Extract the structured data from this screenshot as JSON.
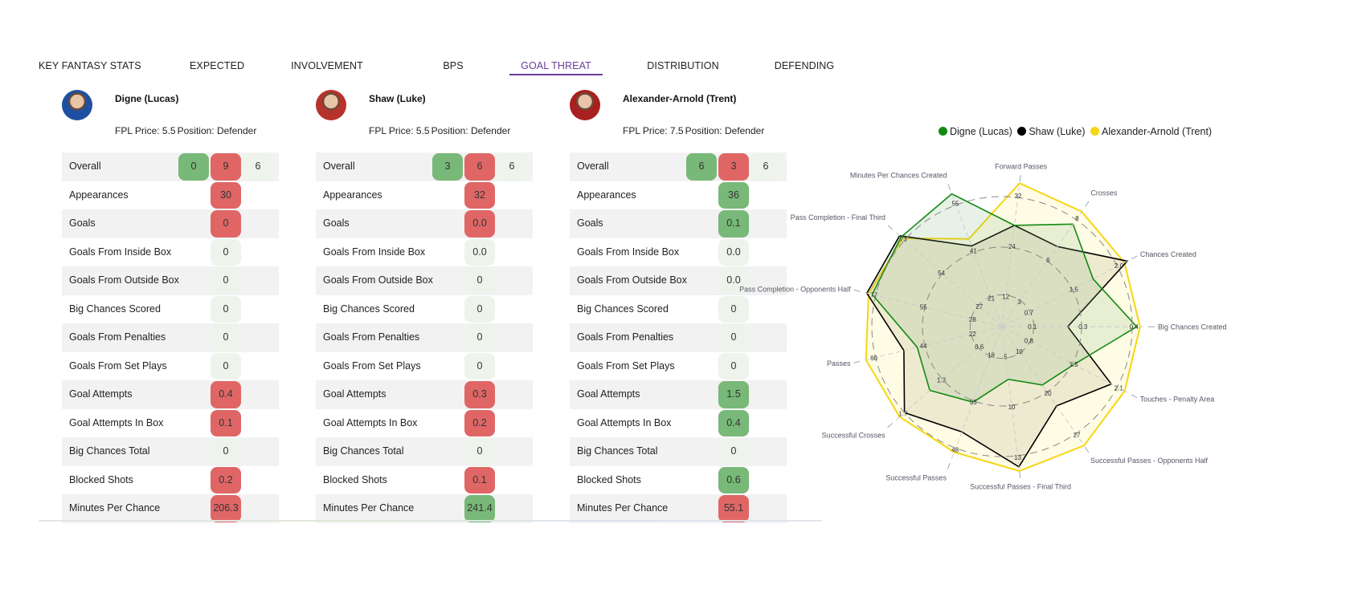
{
  "tabs": [
    {
      "label": "KEY FANTASY STATS",
      "active": false
    },
    {
      "label": "EXPECTED",
      "active": false
    },
    {
      "label": "INVOLVEMENT",
      "active": false
    },
    {
      "label": "BPS",
      "active": false
    },
    {
      "label": "GOAL THREAT",
      "active": true
    },
    {
      "label": "DISTRIBUTION",
      "active": false
    },
    {
      "label": "DEFENDING",
      "active": false
    }
  ],
  "colors": {
    "active_tab": "#6a3d9a",
    "pill_red": "#e06666",
    "pill_green": "#78b878",
    "pill_neutral": "#eef4ec"
  },
  "players": [
    {
      "name": "Digne (Lucas)",
      "price_label": "FPL Price: 5.5",
      "position_label": "Position: Defender",
      "avatar_color": "#1f4fa0",
      "overall": [
        {
          "value": "0",
          "status": "green"
        },
        {
          "value": "9",
          "status": "red"
        },
        {
          "value": "6",
          "status": "neutral"
        }
      ],
      "stats": [
        {
          "label": "Appearances",
          "value": "30",
          "status": "red"
        },
        {
          "label": "Goals",
          "value": "0",
          "status": "red"
        },
        {
          "label": "Goals From Inside Box",
          "value": "0",
          "status": "neutral"
        },
        {
          "label": "Goals From Outside Box",
          "value": "0",
          "status": "neutral"
        },
        {
          "label": "Big Chances Scored",
          "value": "0",
          "status": "neutral"
        },
        {
          "label": "Goals From Penalties",
          "value": "0",
          "status": "neutral"
        },
        {
          "label": "Goals From Set Plays",
          "value": "0",
          "status": "neutral"
        },
        {
          "label": "Goal Attempts",
          "value": "0.4",
          "status": "red"
        },
        {
          "label": "Goal Attempts In Box",
          "value": "0.1",
          "status": "red"
        },
        {
          "label": "Big Chances Total",
          "value": "0",
          "status": "neutral"
        },
        {
          "label": "Blocked Shots",
          "value": "0.2",
          "status": "red"
        },
        {
          "label": "Minutes Per Chance",
          "value": "206.3",
          "status": "red"
        }
      ]
    },
    {
      "name": "Shaw (Luke)",
      "price_label": "FPL Price: 5.5",
      "position_label": "Position: Defender",
      "avatar_color": "#b8322c",
      "overall": [
        {
          "value": "3",
          "status": "green"
        },
        {
          "value": "6",
          "status": "red"
        },
        {
          "value": "6",
          "status": "neutral"
        }
      ],
      "stats": [
        {
          "label": "Appearances",
          "value": "32",
          "status": "red"
        },
        {
          "label": "Goals",
          "value": "0.0",
          "status": "red"
        },
        {
          "label": "Goals From Inside Box",
          "value": "0.0",
          "status": "neutral"
        },
        {
          "label": "Goals From Outside Box",
          "value": "0",
          "status": "neutral"
        },
        {
          "label": "Big Chances Scored",
          "value": "0",
          "status": "neutral"
        },
        {
          "label": "Goals From Penalties",
          "value": "0",
          "status": "neutral"
        },
        {
          "label": "Goals From Set Plays",
          "value": "0",
          "status": "neutral"
        },
        {
          "label": "Goal Attempts",
          "value": "0.3",
          "status": "red"
        },
        {
          "label": "Goal Attempts In Box",
          "value": "0.2",
          "status": "red"
        },
        {
          "label": "Big Chances Total",
          "value": "0",
          "status": "neutral"
        },
        {
          "label": "Blocked Shots",
          "value": "0.1",
          "status": "red"
        },
        {
          "label": "Minutes Per Chance",
          "value": "241.4",
          "status": "green"
        }
      ]
    },
    {
      "name": "Alexander-Arnold (Trent)",
      "price_label": "FPL Price: 7.5",
      "position_label": "Position: Defender",
      "avatar_color": "#a8201f",
      "overall": [
        {
          "value": "6",
          "status": "green"
        },
        {
          "value": "3",
          "status": "red"
        },
        {
          "value": "6",
          "status": "neutral"
        }
      ],
      "stats": [
        {
          "label": "Appearances",
          "value": "36",
          "status": "green"
        },
        {
          "label": "Goals",
          "value": "0.1",
          "status": "green"
        },
        {
          "label": "Goals From Inside Box",
          "value": "0.0",
          "status": "neutral"
        },
        {
          "label": "Goals From Outside Box",
          "value": "0.0",
          "status": "neutral"
        },
        {
          "label": "Big Chances Scored",
          "value": "0",
          "status": "neutral"
        },
        {
          "label": "Goals From Penalties",
          "value": "0",
          "status": "neutral"
        },
        {
          "label": "Goals From Set Plays",
          "value": "0",
          "status": "neutral"
        },
        {
          "label": "Goal Attempts",
          "value": "1.5",
          "status": "green"
        },
        {
          "label": "Goal Attempts In Box",
          "value": "0.4",
          "status": "green"
        },
        {
          "label": "Big Chances Total",
          "value": "0",
          "status": "neutral"
        },
        {
          "label": "Blocked Shots",
          "value": "0.6",
          "status": "green"
        },
        {
          "label": "Minutes Per Chance",
          "value": "55.1",
          "status": "red"
        }
      ]
    }
  ],
  "overall_label": "Overall",
  "chart_data": {
    "type": "radar",
    "title": "",
    "legend": {
      "placement": "top",
      "entries": [
        {
          "name": "Digne (Lucas)",
          "color": "#138a13"
        },
        {
          "name": "Shaw (Luke)",
          "color": "#000000"
        },
        {
          "name": "Alexander-Arnold (Trent)",
          "color": "#f5d614"
        }
      ]
    },
    "axes": [
      {
        "label": "Forward Passes",
        "ticks": [
          "12",
          "24",
          "32"
        ]
      },
      {
        "label": "Crosses",
        "ticks": [
          "3",
          "6",
          "8"
        ]
      },
      {
        "label": "Chances Created",
        "ticks": [
          "0.7",
          "1.5",
          "2.0"
        ]
      },
      {
        "label": "Big Chances Created",
        "ticks": [
          "0.1",
          "0.3",
          "0.4"
        ]
      },
      {
        "label": "Touches - Penalty Area",
        "ticks": [
          "0.8",
          "1.5",
          "2.1"
        ]
      },
      {
        "label": "Successful Passes - Opponents Half",
        "ticks": [
          "10",
          "20",
          "27"
        ]
      },
      {
        "label": "Successful Passes - Final Third",
        "ticks": [
          "5",
          "10",
          "13"
        ]
      },
      {
        "label": "Successful Passes",
        "ticks": [
          "18",
          "35",
          "48"
        ]
      },
      {
        "label": "Successful Crosses",
        "ticks": [
          "0.6",
          "1.3",
          "1.7"
        ]
      },
      {
        "label": "Passes",
        "ticks": [
          "22",
          "44",
          "60"
        ]
      },
      {
        "label": "Pass Completion - Opponents Half",
        "ticks": [
          "28",
          "55",
          "77"
        ]
      },
      {
        "label": "Pass Completion - Final Third",
        "ticks": [
          "27",
          "54",
          "73"
        ]
      },
      {
        "label": "Minutes Per Chances Created",
        "ticks": [
          "21",
          "41",
          "55"
        ]
      }
    ],
    "tick_fractions": [
      0.35,
      0.7,
      0.96
    ],
    "series": [
      {
        "name": "Digne (Lucas)",
        "color": "#138a13",
        "values": [
          24,
          8.2,
          1.6,
          0.41,
          1.35,
          14,
          5,
          28,
          1.2,
          38,
          74,
          70,
          56
        ]
      },
      {
        "name": "Shaw (Luke)",
        "color": "#000000",
        "values": [
          24,
          6.4,
          2.2,
          0.2,
          2.05,
          19,
          13.3,
          39,
          1.62,
          44,
          77,
          71,
          34
        ]
      },
      {
        "name": "Alexander-Arnold (Trent)",
        "color": "#f5d614",
        "values": [
          34,
          9.2,
          2.15,
          0.42,
          2.3,
          28.5,
          13.7,
          46.5,
          1.7,
          61,
          76,
          69,
          37
        ]
      }
    ],
    "axis_max": [
      34,
      9.5,
      2.25,
      0.44,
      2.4,
      28.5,
      13.6,
      50,
      1.8,
      63,
      80,
      75,
      57
    ],
    "grid": "dashed-circles"
  }
}
